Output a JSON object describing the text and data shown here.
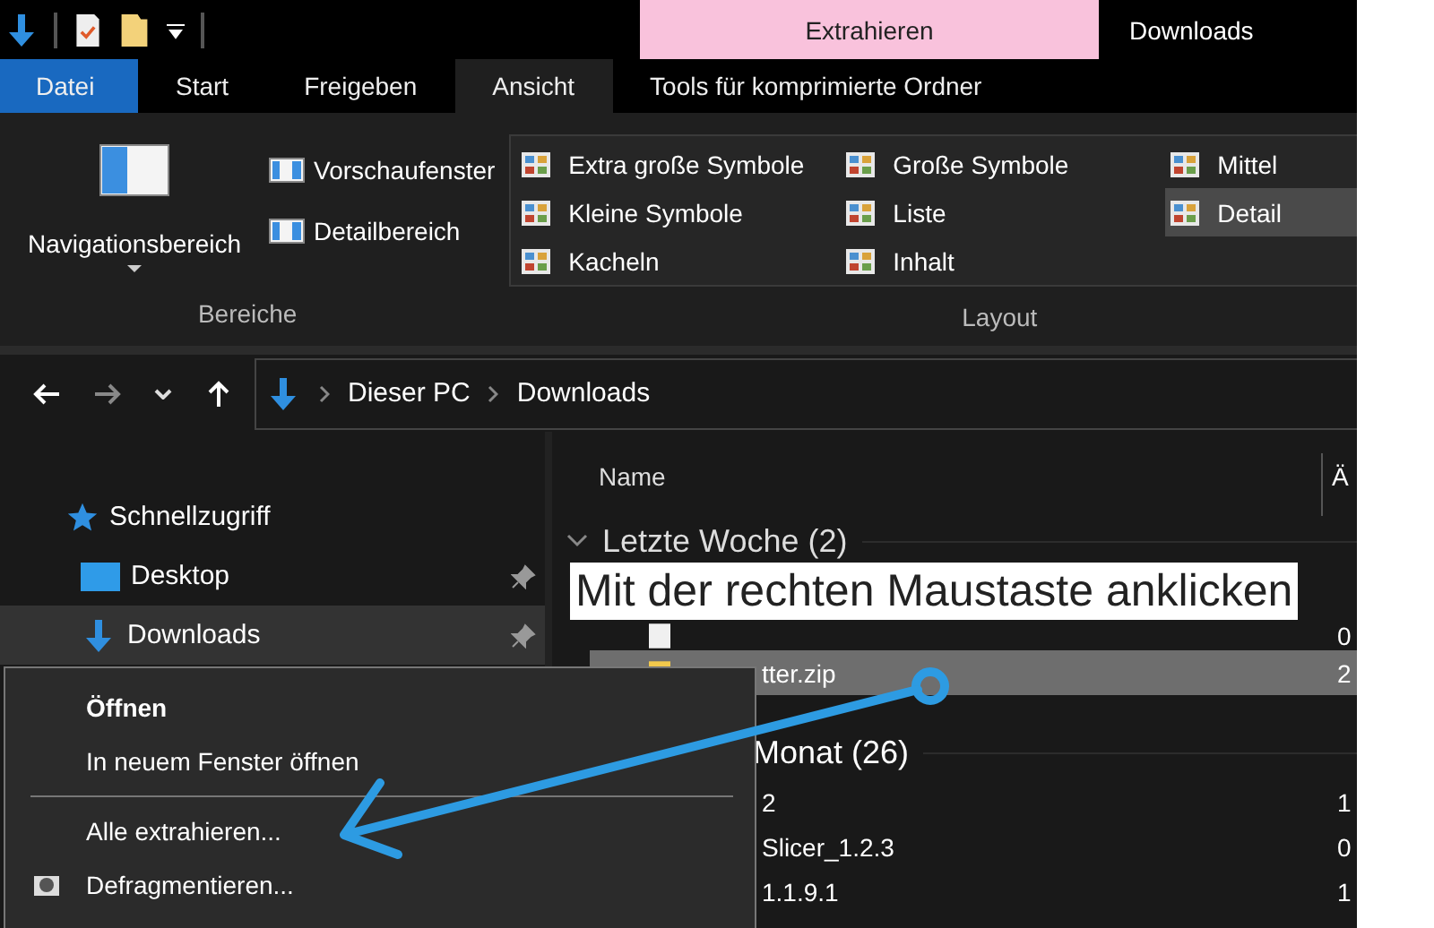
{
  "title_bar": {
    "context_tab": "Extrahieren",
    "title": "Downloads"
  },
  "ribbon_tabs": [
    {
      "label": "Datei",
      "kind": "file",
      "selected": false
    },
    {
      "label": "Start",
      "kind": "tab",
      "selected": false
    },
    {
      "label": "Freigeben",
      "kind": "tab",
      "selected": false
    },
    {
      "label": "Ansicht",
      "kind": "tab",
      "selected": true
    },
    {
      "label": "Tools für komprimierte Ordner",
      "kind": "tab",
      "selected": false
    }
  ],
  "panes_group": {
    "label": "Bereiche",
    "large_button": "Navigationsbereich",
    "buttons": [
      "Vorschaufenster",
      "Detailbereich"
    ]
  },
  "layout_group": {
    "label": "Layout",
    "options": [
      {
        "label": "Extra große Symbole",
        "selected": false
      },
      {
        "label": "Große Symbole",
        "selected": false
      },
      {
        "label": "Mittel",
        "selected": false
      },
      {
        "label": "Kleine Symbole",
        "selected": false
      },
      {
        "label": "Liste",
        "selected": false
      },
      {
        "label": "Detail",
        "selected": true
      },
      {
        "label": "Kacheln",
        "selected": false
      },
      {
        "label": "Inhalt",
        "selected": false
      }
    ]
  },
  "address_bar": {
    "path": [
      "Dieser PC",
      "Downloads"
    ]
  },
  "navigation_pane": {
    "items": [
      {
        "label": "Schnellzugriff",
        "kind": "quick",
        "pinned": false,
        "selected": false
      },
      {
        "label": "Desktop",
        "kind": "desktop",
        "pinned": true,
        "selected": false
      },
      {
        "label": "Downloads",
        "kind": "downloads",
        "pinned": true,
        "selected": true
      }
    ]
  },
  "file_list": {
    "columns": [
      "Name",
      "Ä"
    ],
    "groups": [
      {
        "label": "Letzte Woche (2)",
        "rows": [
          {
            "name": "",
            "column_2": "0",
            "selected": false
          },
          {
            "name": "tter.zip",
            "column_2": "2",
            "selected": true
          }
        ]
      },
      {
        "label": "Monat (26)",
        "rows": [
          {
            "name": "2",
            "column_2": "1",
            "selected": false
          },
          {
            "name": "Slicer_1.2.3",
            "column_2": "0",
            "selected": false
          },
          {
            "name": "1.1.9.1",
            "column_2": "1",
            "selected": false
          }
        ]
      }
    ]
  },
  "context_menu": {
    "items": [
      {
        "kind": "default",
        "label": "Öffnen"
      },
      {
        "kind": "item",
        "label": "In neuem Fenster öffnen"
      },
      {
        "kind": "separator"
      },
      {
        "kind": "item",
        "label": "Alle extrahieren..."
      },
      {
        "kind": "icon-item",
        "label": "Defragmentieren..."
      }
    ]
  },
  "annotation": {
    "label": "Mit der rechten Maustaste anklicken"
  }
}
